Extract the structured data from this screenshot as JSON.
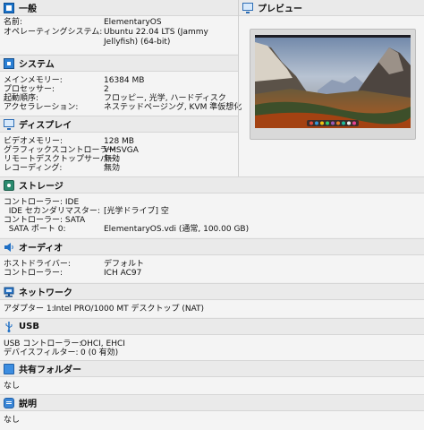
{
  "general": {
    "title": "一般",
    "rows": [
      {
        "k": "名前:",
        "v": "ElementaryOS"
      },
      {
        "k": "オペレーティングシステム:",
        "v": "Ubuntu 22.04 LTS (Jammy"
      },
      {
        "k": "",
        "v": "Jellyfish) (64-bit)"
      }
    ]
  },
  "preview": {
    "title": "プレビュー"
  },
  "system": {
    "title": "システム",
    "rows": [
      {
        "k": "メインメモリー:",
        "v": "16384 MB"
      },
      {
        "k": "プロセッサー:",
        "v": "2"
      },
      {
        "k": "起動順序:",
        "v": "フロッピー, 光学, ハードディスク"
      },
      {
        "k": "アクセラレーション:",
        "v": "ネステッドページング, KVM 準仮想化"
      }
    ]
  },
  "display": {
    "title": "ディスプレイ",
    "rows": [
      {
        "k": "ビデオメモリー:",
        "v": "128 MB"
      },
      {
        "k": "グラフィックスコントローラー:",
        "v": "VMSVGA"
      },
      {
        "k": "リモートデスクトップサーバー:",
        "v": "無効"
      },
      {
        "k": "レコーディング:",
        "v": "無効"
      }
    ]
  },
  "storage": {
    "title": "ストレージ",
    "rows": [
      {
        "k": "コントローラー: IDE",
        "v": ""
      },
      {
        "k": "  IDE セカンダリマスター:",
        "v": "[光学ドライブ] 空"
      },
      {
        "k": "コントローラー: SATA",
        "v": ""
      },
      {
        "k": "  SATA ポート 0:",
        "v": "ElementaryOS.vdi (通常, 100.00 GB)"
      }
    ]
  },
  "audio": {
    "title": "オーディオ",
    "rows": [
      {
        "k": "ホストドライバー:",
        "v": "デフォルト"
      },
      {
        "k": "コントローラー:",
        "v": "ICH AC97"
      }
    ]
  },
  "network": {
    "title": "ネットワーク",
    "rows": [
      {
        "k": "アダプター 1:",
        "v": "Intel PRO/1000 MT デスクトップ (NAT)"
      }
    ]
  },
  "usb": {
    "title": "USB",
    "rows": [
      {
        "k": "USB コントローラー:",
        "v": "OHCI, EHCI"
      },
      {
        "k": "デバイスフィルター:",
        "v": "0 (0 有効)"
      }
    ]
  },
  "shared": {
    "title": "共有フォルダー",
    "value": "なし"
  },
  "description": {
    "title": "説明",
    "value": "なし"
  }
}
